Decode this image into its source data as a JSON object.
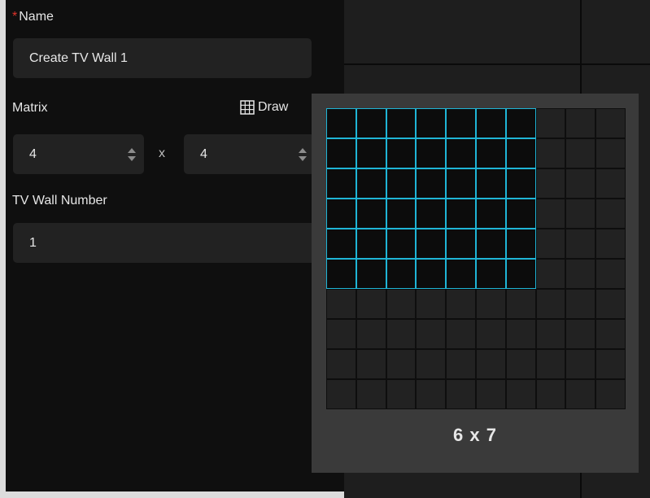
{
  "form": {
    "name_required_mark": "*",
    "name_label": "Name",
    "name_value": "Create TV Wall 1",
    "matrix_label": "Matrix",
    "draw_label": "Draw",
    "rows_value": "4",
    "times_sign": "x",
    "cols_value": "4",
    "wall_number_label": "TV Wall Number",
    "wall_number_value": "1"
  },
  "matrix_picker": {
    "total_rows": 10,
    "total_cols": 10,
    "selected_rows": 6,
    "selected_cols": 7,
    "selection_text": "6 x 7"
  },
  "colors": {
    "selection_border": "#1fb5d6",
    "required_mark": "#e0342b"
  }
}
